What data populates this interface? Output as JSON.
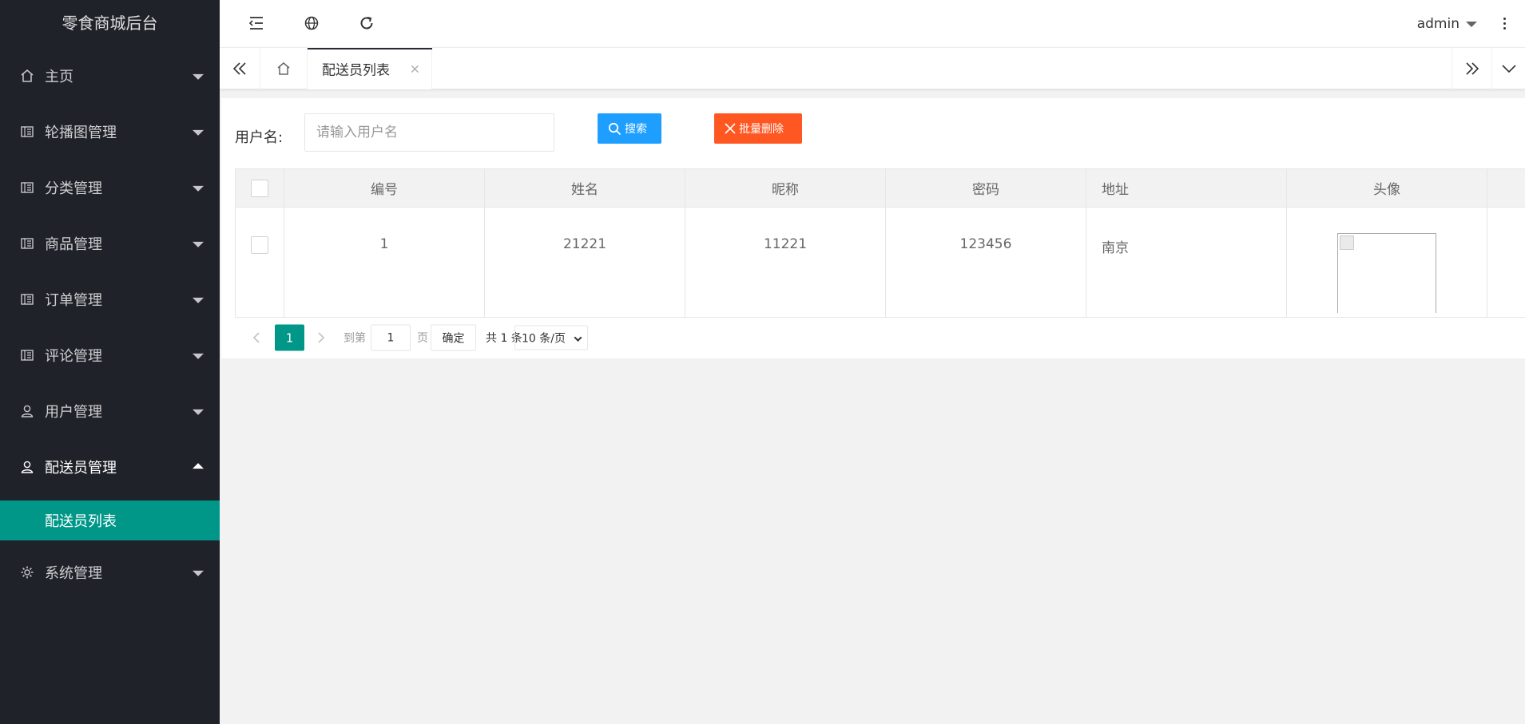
{
  "app": {
    "title": "零食商城后台"
  },
  "sidebar": {
    "items": [
      {
        "label": "主页",
        "icon": "home-icon"
      },
      {
        "label": "轮播图管理",
        "icon": "template-icon"
      },
      {
        "label": "分类管理",
        "icon": "template-icon"
      },
      {
        "label": "商品管理",
        "icon": "template-icon"
      },
      {
        "label": "订单管理",
        "icon": "template-icon"
      },
      {
        "label": "评论管理",
        "icon": "template-icon"
      },
      {
        "label": "用户管理",
        "icon": "user-icon"
      },
      {
        "label": "配送员管理",
        "icon": "user-icon",
        "expanded": true,
        "children": [
          {
            "label": "配送员列表",
            "active": true
          }
        ]
      },
      {
        "label": "系统管理",
        "icon": "gear-icon"
      }
    ]
  },
  "header": {
    "icons": [
      "shrink-menu-icon",
      "globe-icon",
      "refresh-icon"
    ],
    "user": "admin"
  },
  "tabs": {
    "active_label": "配送员列表",
    "close": "×"
  },
  "search": {
    "label": "用户名:",
    "placeholder": "请输入用户名",
    "search_button": "搜索",
    "batch_delete_button": "批量删除"
  },
  "table": {
    "columns": [
      "编号",
      "姓名",
      "昵称",
      "密码",
      "地址",
      "头像"
    ],
    "rows": [
      {
        "id": "1",
        "name": "21221",
        "nickname": "11221",
        "password": "123456",
        "address": "南京"
      }
    ]
  },
  "pagination": {
    "current_page": "1",
    "goto_label": "到第",
    "goto_value": "1",
    "page_label": "页",
    "confirm_label": "确定",
    "total_label": "共 1 条",
    "page_size_label": "10 条/页"
  },
  "colors": {
    "sidebar_bg": "#20222a",
    "accent": "#009688",
    "search_button": "#1e9fff",
    "delete_button": "#ff5722"
  }
}
